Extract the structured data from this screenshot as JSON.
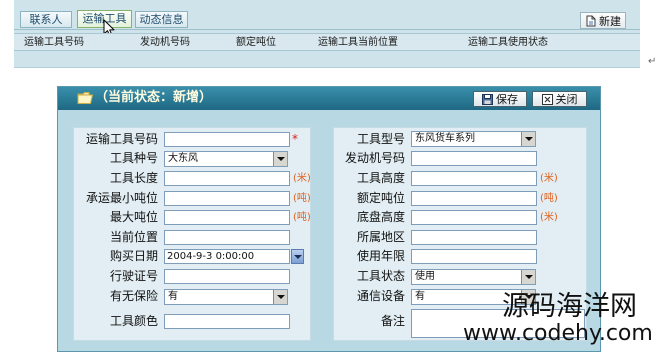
{
  "top_panel": {
    "tabs": [
      {
        "label": "联系人",
        "selected": false
      },
      {
        "label": "运输工具",
        "selected": true
      },
      {
        "label": "动态信息",
        "selected": false
      }
    ],
    "new_button": {
      "label": "新建",
      "icon": "new-document-icon"
    },
    "columns": [
      "运输工具号码",
      "发动机号码",
      "额定吨位",
      "运输工具当前位置",
      "运输工具使用状态"
    ],
    "paragraph_mark": "↵"
  },
  "form_panel": {
    "title": "（当前状态：新增）",
    "title_icon": "folder-icon",
    "save_button": {
      "label": "保存",
      "icon": "save-disk-icon"
    },
    "close_button": {
      "label": "关闭",
      "icon": "close-box-icon"
    },
    "left_fields": [
      {
        "label": "运输工具号码",
        "required_mark": "*"
      },
      {
        "label": "工具种号",
        "value": "大东风"
      },
      {
        "label": "工具长度",
        "unit": "(米)"
      },
      {
        "label": "承运最小吨位",
        "unit": "(吨)"
      },
      {
        "label": "最大吨位",
        "unit": "(吨)"
      },
      {
        "label": "当前位置"
      },
      {
        "label": "购买日期",
        "value": "2004-9-3 0:00:00"
      },
      {
        "label": "行驶证号"
      },
      {
        "label": "有无保险",
        "value": "有"
      },
      {
        "label": "工具颜色"
      }
    ],
    "right_fields": [
      {
        "label": "工具型号",
        "value": "东风货车系列"
      },
      {
        "label": "发动机号码"
      },
      {
        "label": "工具高度",
        "unit": "(米)"
      },
      {
        "label": "额定吨位",
        "unit": "(吨)"
      },
      {
        "label": "底盘高度",
        "unit": "(米)"
      },
      {
        "label": "所属地区"
      },
      {
        "label": "使用年限"
      },
      {
        "label": "工具状态",
        "value": "使用"
      },
      {
        "label": "通信设备",
        "value": "有"
      },
      {
        "label": "备注"
      }
    ]
  },
  "watermark": {
    "line1": "源码海洋网",
    "line2": "www.codehy.com"
  },
  "colors": {
    "top_panel_bg": "#cfe3eb",
    "form_header_bg": "#2a7a95",
    "form_title": "#fffbe0",
    "unit_text": "#e0601a",
    "required_mark": "#e02020"
  }
}
